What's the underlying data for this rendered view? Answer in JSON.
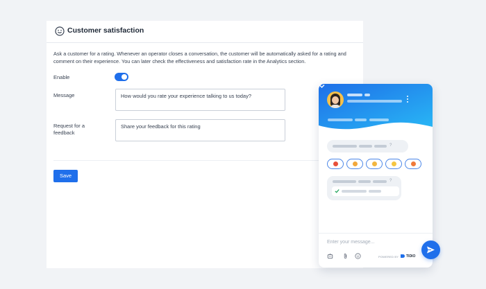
{
  "settings": {
    "title": "Customer satisfaction",
    "description": "Ask a customer for a rating. Whenever an operator closes a conversation, the customer will be automatically asked for a rating and comment on their experience. You can later check the effectiveness and satisfaction rate in the Analytics section.",
    "enable_label": "Enable",
    "enable_on": true,
    "message_label": "Message",
    "message_value": "How would you rate your experience talking to us today?",
    "feedback_label_line1": "Request for a",
    "feedback_label_line2": "feedback",
    "feedback_value": "Share your feedback for this rating",
    "save_label": "Save"
  },
  "widget": {
    "input_placeholder": "Enter your message...",
    "powered_by": "POWERED BY",
    "brand": "TIDIO",
    "header_gradient": [
      "#1e6fe8",
      "#29b7f5"
    ],
    "emoji_colors": [
      "#e8503a",
      "#f2a83b",
      "#f2b640",
      "#f5c542",
      "#f07a3a"
    ],
    "footer_icons": [
      "bot-icon",
      "attachment-icon",
      "emoji-icon"
    ]
  },
  "colors": {
    "accent": "#1f6feb",
    "background": "#f1f3f6"
  }
}
